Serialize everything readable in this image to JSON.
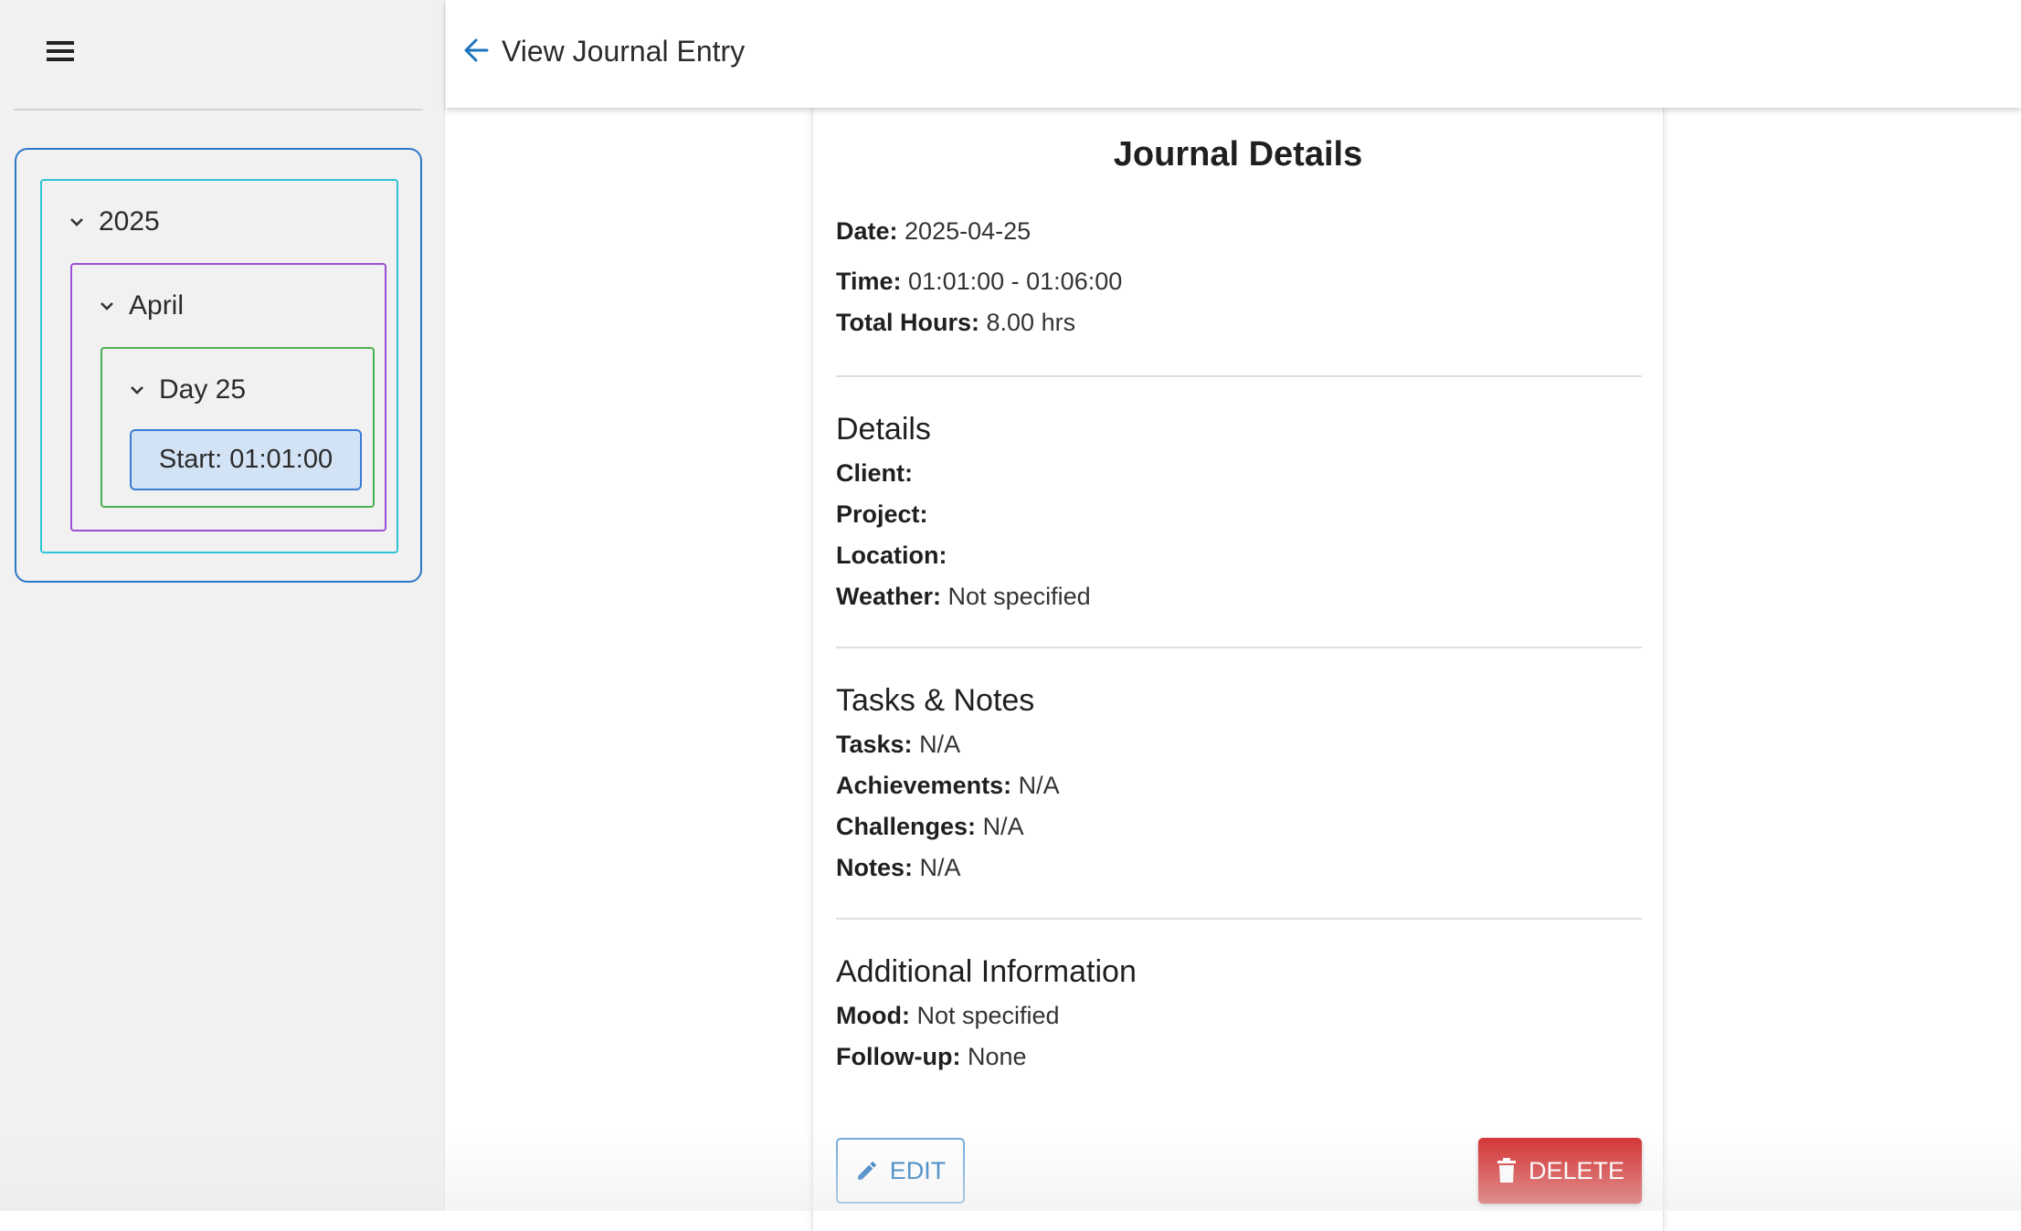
{
  "topbar": {
    "title": "View Journal Entry"
  },
  "tree": {
    "year": "2025",
    "month": "April",
    "day": "Day 25",
    "entry": "Start: 01:01:00"
  },
  "card": {
    "title": "Journal Details",
    "summary": {
      "date_label": "Date:",
      "date_value": "2025-04-25",
      "time_label": "Time:",
      "time_value": "01:01:00 - 01:06:00",
      "hours_label": "Total Hours:",
      "hours_value": "8.00 hrs"
    },
    "details": {
      "heading": "Details",
      "client_label": "Client:",
      "client_value": "",
      "project_label": "Project:",
      "project_value": "",
      "location_label": "Location:",
      "location_value": "",
      "weather_label": "Weather:",
      "weather_value": "Not specified"
    },
    "tasks": {
      "heading": "Tasks & Notes",
      "tasks_label": "Tasks:",
      "tasks_value": "N/A",
      "achievements_label": "Achievements:",
      "achievements_value": "N/A",
      "challenges_label": "Challenges:",
      "challenges_value": "N/A",
      "notes_label": "Notes:",
      "notes_value": "N/A"
    },
    "additional": {
      "heading": "Additional Information",
      "mood_label": "Mood:",
      "mood_value": "Not specified",
      "followup_label": "Follow-up:",
      "followup_value": "None"
    },
    "actions": {
      "edit_label": "EDIT",
      "delete_label": "DELETE"
    }
  },
  "colors": {
    "accent": "#1e73be",
    "danger": "#d32f2f",
    "year_border": "#2ec4d6",
    "month_border": "#9a4fd6",
    "day_border": "#4cb050",
    "entry_bg": "#d3e3f6"
  },
  "icons": {
    "menu": "menu-icon",
    "back": "arrow-left-icon",
    "chevron": "chevron-down-icon",
    "edit": "pencil-icon",
    "delete": "trash-icon"
  }
}
